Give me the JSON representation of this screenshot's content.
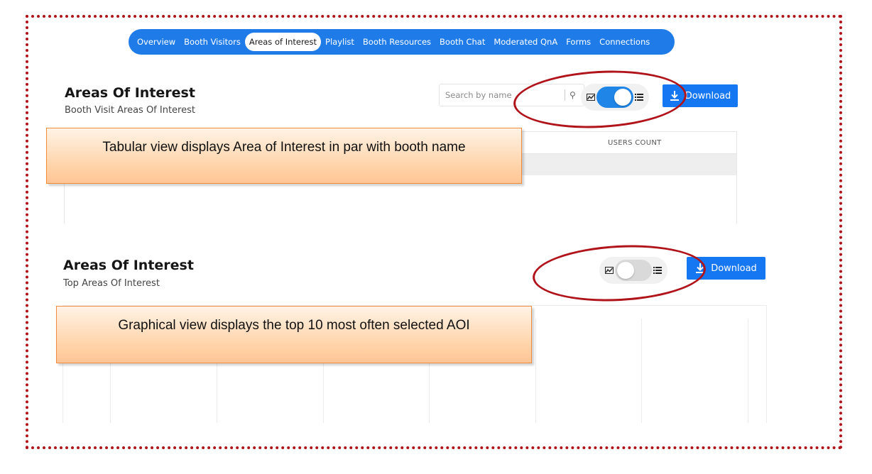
{
  "tabs": [
    {
      "label": "Overview"
    },
    {
      "label": "Booth Visitors"
    },
    {
      "label": "Areas of Interest",
      "active": true
    },
    {
      "label": "Playlist"
    },
    {
      "label": "Booth Resources"
    },
    {
      "label": "Booth Chat"
    },
    {
      "label": "Moderated QnA"
    },
    {
      "label": "Forms"
    },
    {
      "label": "Connections"
    }
  ],
  "section_table": {
    "title": "Areas Of Interest",
    "subtitle": "Booth Visit Areas Of Interest",
    "search_placeholder": "Search by name",
    "toggle_state": "on",
    "download_label": "Download",
    "columns": [
      "USERS COUNT"
    ],
    "callout": "Tabular view displays Area of Interest in par with booth name"
  },
  "section_graph": {
    "title": "Areas Of Interest",
    "subtitle": "Top Areas Of Interest",
    "toggle_state": "off",
    "download_label": "Download",
    "callout": "Graphical view displays the top 10 most often selected AOI"
  },
  "colors": {
    "accent": "#1f7be8",
    "annotation": "#b0141a",
    "callout_border": "#f08c3c"
  },
  "icons": [
    "chart-icon",
    "list-icon",
    "search-icon",
    "download-icon"
  ]
}
